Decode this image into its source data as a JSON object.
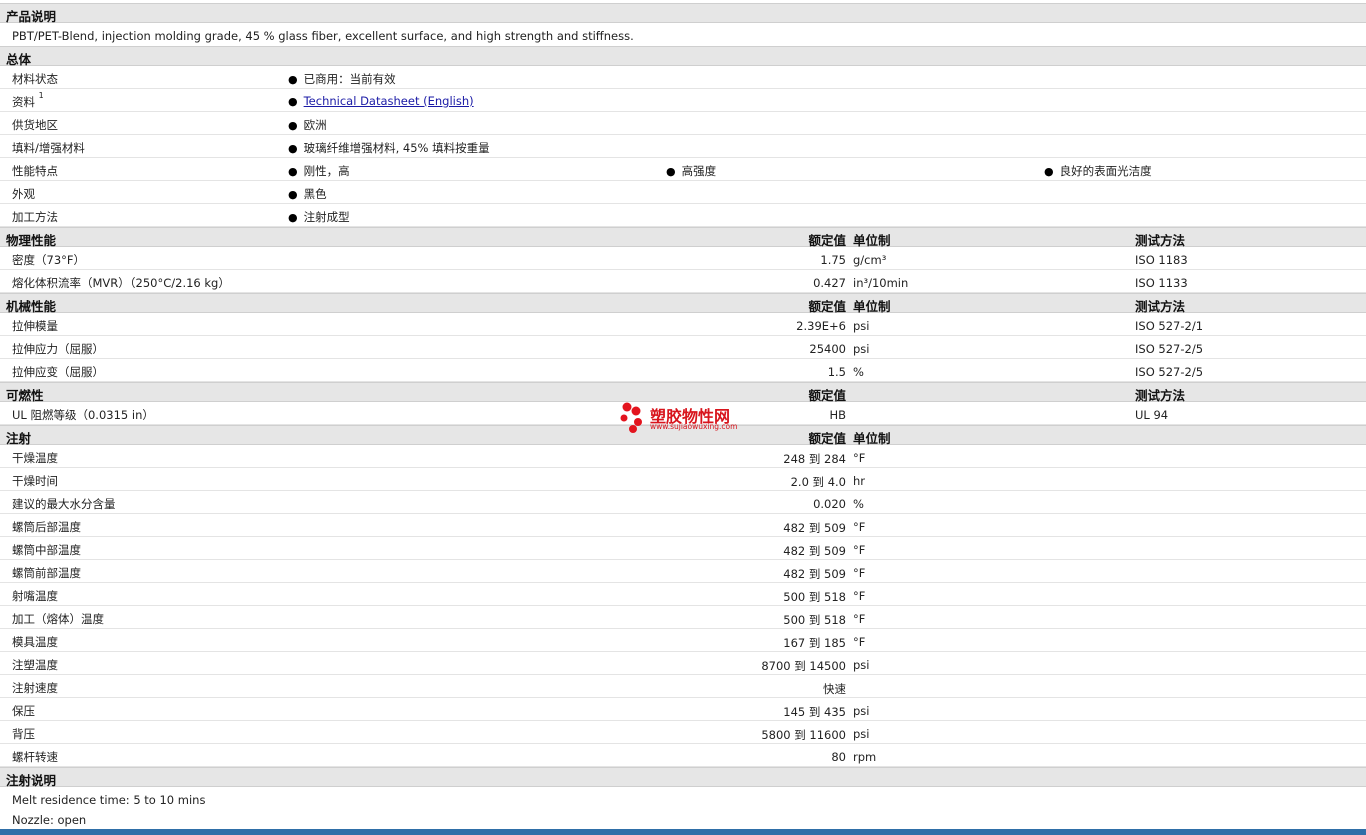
{
  "sections": {
    "desc_title": "产品说明",
    "desc_text": "PBT/PET-Blend, injection molding grade, 45 % glass fiber, excellent surface, and high strength and stiffness.",
    "general_title": "总体",
    "physical_title": "物理性能",
    "mechanical_title": "机械性能",
    "flammability_title": "可燃性",
    "injection_title": "注射",
    "injection_notes_title": "注射说明"
  },
  "headers": {
    "nominal": "额定值",
    "unit": "单位制",
    "method": "测试方法"
  },
  "general": {
    "status_label": "材料状态",
    "status_value": "已商用：当前有效",
    "docs_label": "资料",
    "docs_sup": "1",
    "docs_link": "Technical Datasheet (English)",
    "region_label": "供货地区",
    "region_value": "欧洲",
    "filler_label": "填料/增强材料",
    "filler_value": "玻璃纤维增强材料, 45% 填料按重量",
    "features_label": "性能特点",
    "feature_1": "刚性，高",
    "feature_2": "高强度",
    "feature_3": "良好的表面光洁度",
    "appearance_label": "外观",
    "appearance_value": "黑色",
    "process_label": "加工方法",
    "process_value": "注射成型"
  },
  "physical": [
    {
      "label": "密度（73°F）",
      "value": "1.75",
      "unit": "g/cm³",
      "method": "ISO 1183"
    },
    {
      "label": "熔化体积流率（MVR）（250°C/2.16 kg）",
      "value": "0.427",
      "unit": "in³/10min",
      "method": "ISO 1133"
    }
  ],
  "mechanical": [
    {
      "label": "拉伸模量",
      "value": "2.39E+6",
      "unit": "psi",
      "method": "ISO 527-2/1"
    },
    {
      "label": "拉伸应力（屈服）",
      "value": "25400",
      "unit": "psi",
      "method": "ISO 527-2/5"
    },
    {
      "label": "拉伸应变（屈服）",
      "value": "1.5",
      "unit": "%",
      "method": "ISO 527-2/5"
    }
  ],
  "flammability": [
    {
      "label": "UL 阻燃等级（0.0315 in）",
      "value": "HB",
      "unit": "",
      "method": "UL 94"
    }
  ],
  "injection": [
    {
      "label": "干燥温度",
      "value": "248 到  284",
      "unit": "°F"
    },
    {
      "label": "干燥时间",
      "value": "2.0 到  4.0",
      "unit": "hr"
    },
    {
      "label": "建议的最大水分含量",
      "value": "0.020",
      "unit": "%"
    },
    {
      "label": "螺筒后部温度",
      "value": "482 到  509",
      "unit": "°F"
    },
    {
      "label": "螺筒中部温度",
      "value": "482 到  509",
      "unit": "°F"
    },
    {
      "label": "螺筒前部温度",
      "value": "482 到  509",
      "unit": "°F"
    },
    {
      "label": "射嘴温度",
      "value": "500 到  518",
      "unit": "°F"
    },
    {
      "label": "加工（熔体）温度",
      "value": "500 到  518",
      "unit": "°F"
    },
    {
      "label": "模具温度",
      "value": "167 到  185",
      "unit": "°F"
    },
    {
      "label": "注塑温度",
      "value": "8700 到  14500",
      "unit": "psi"
    },
    {
      "label": "注射速度",
      "value": "快速",
      "unit": ""
    },
    {
      "label": "保压",
      "value": "145 到  435",
      "unit": "psi"
    },
    {
      "label": "背压",
      "value": "5800 到  11600",
      "unit": "psi"
    },
    {
      "label": "螺杆转速",
      "value": "80",
      "unit": "rpm"
    }
  ],
  "injection_notes": [
    "Melt residence time: 5 to 10 mins",
    "Nozzle: open"
  ],
  "watermark": {
    "name": "塑胶物性网",
    "url": "www.sujiaowuxing.com"
  }
}
